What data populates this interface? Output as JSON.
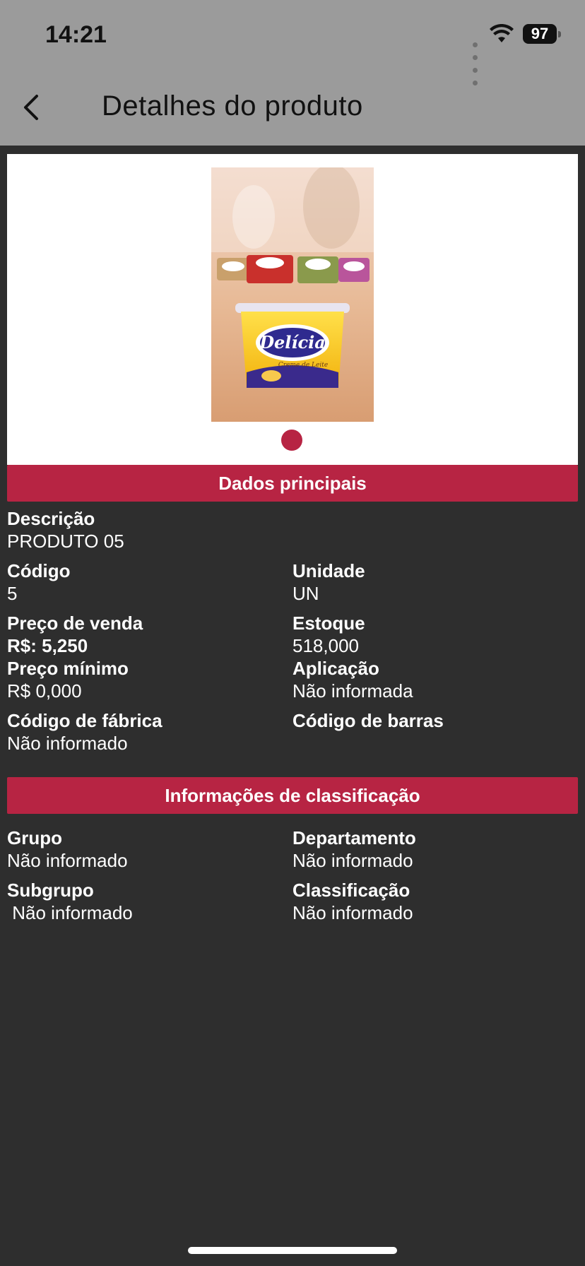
{
  "status_bar": {
    "time": "14:21",
    "battery": "97"
  },
  "header": {
    "title": "Detalhes do produto"
  },
  "product_image": {
    "brand": "Delícia",
    "tagline": "Creme de Leite"
  },
  "dados_principais": {
    "section_title": "Dados principais",
    "descricao_label": "Descrição",
    "descricao_value": "PRODUTO 05",
    "codigo_label": "Código",
    "codigo_value": "5",
    "unidade_label": "Unidade",
    "unidade_value": "UN",
    "preco_venda_label": "Preço de venda",
    "preco_venda_value": "R$: 5,250",
    "estoque_label": "Estoque",
    "estoque_value": "518,000",
    "preco_minimo_label": "Preço mínimo",
    "preco_minimo_value": "R$ 0,000",
    "aplicacao_label": "Aplicação",
    "aplicacao_value": "Não informada",
    "codigo_fabrica_label": "Código de fábrica",
    "codigo_fabrica_value": "Não informado",
    "codigo_barras_label": "Código de barras",
    "codigo_barras_value": ""
  },
  "classificacao": {
    "section_title": "Informações de classificação",
    "grupo_label": "Grupo",
    "grupo_value": "Não informado",
    "departamento_label": "Departamento",
    "departamento_value": "Não informado",
    "subgrupo_label": "Subgrupo",
    "subgrupo_value": " Não informado",
    "classificacao_label": "Classificação",
    "classificacao_value": "Não informado"
  },
  "colors": {
    "accent": "#b72443",
    "background": "#2e2e2e",
    "header": "#9b9b9b"
  }
}
